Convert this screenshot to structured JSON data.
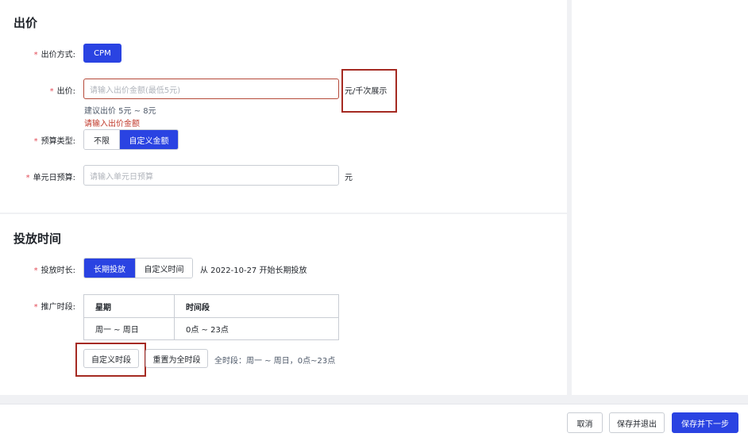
{
  "bid_section": {
    "title": "出价",
    "bid_mode": {
      "label": "出价方式:",
      "button": "CPM"
    },
    "bid_amount": {
      "label": "出价:",
      "placeholder": "请输入出价金额(最低5元)",
      "unit": "元/千次展示",
      "suggestion": "建议出价 5元 ~ 8元",
      "error": "请输入出价金额"
    },
    "budget_type": {
      "label": "预算类型:",
      "options": [
        "不限",
        "自定义金额"
      ],
      "selected": "自定义金额"
    },
    "daily_budget": {
      "label": "单元日预算:",
      "placeholder": "请输入单元日预算",
      "unit": "元"
    }
  },
  "schedule_section": {
    "title": "投放时间",
    "duration": {
      "label": "投放时长:",
      "options": [
        "长期投放",
        "自定义时间"
      ],
      "selected": "长期投放",
      "note": "从 2022-10-27 开始长期投放"
    },
    "time_slots": {
      "label": "推广时段:",
      "columns": [
        "星期",
        "时间段"
      ],
      "rows": [
        [
          "周一 ~ 周日",
          "0点 ~ 23点"
        ]
      ],
      "custom_button": "自定义时段",
      "reset_button": "重置为全时段",
      "summary": "全时段：周一 ~ 周日，0点~23点"
    }
  },
  "footer": {
    "cancel": "取消",
    "save_exit": "保存并退出",
    "save_next": "保存并下一步"
  },
  "colors": {
    "primary": "#2a43e2",
    "error": "#c0392b",
    "highlight_box": "#a52a22"
  }
}
